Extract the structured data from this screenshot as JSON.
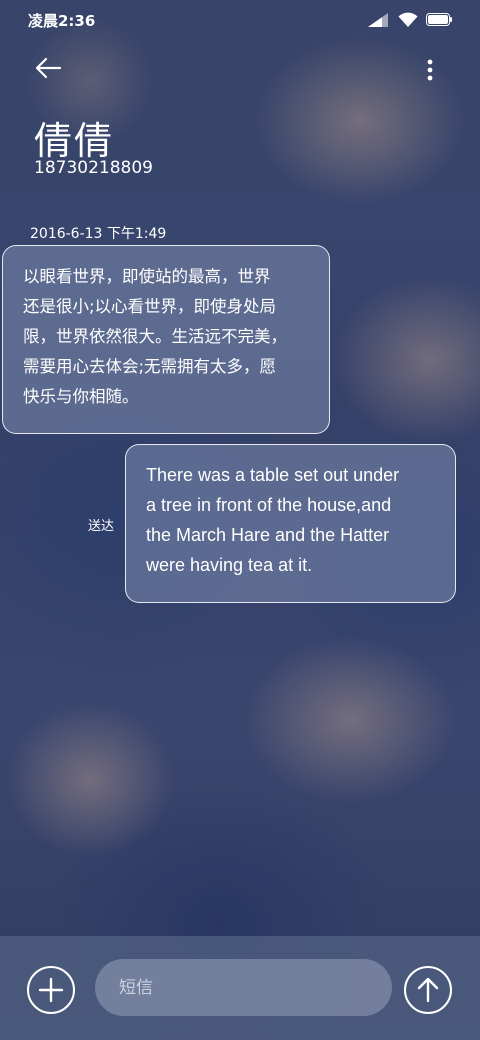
{
  "status_bar": {
    "time": "凌晨2:36"
  },
  "header": {
    "back_icon": "arrow-left-icon",
    "more_icon": "more-vertical-icon",
    "contact_name": "倩倩",
    "contact_number": "18730218809"
  },
  "conversation": {
    "timestamp": "2016-6-13 下午1:49",
    "messages": [
      {
        "direction": "incoming",
        "lines": [
          "以眼看世界，即使站的最高，世界",
          "还是很小;以心看世界，即使身处局",
          "限，世界依然很大。生活远不完美，",
          "需要用心去体会;无需拥有太多，愿",
          "快乐与你相随。"
        ]
      },
      {
        "direction": "outgoing",
        "status": "送达",
        "lines": [
          "There was a table set out under",
          "a tree in front of the house,and",
          "the March Hare and the Hatter",
          "were having tea at it."
        ]
      }
    ]
  },
  "compose": {
    "add_icon": "plus-circle-icon",
    "placeholder": "短信",
    "value": "",
    "send_icon": "arrow-up-circle-icon"
  },
  "colors": {
    "bubble_fill": "#7e8cb0",
    "bubble_border": "#ffffff",
    "compose_bar": "#4e5e80",
    "text": "#ffffff"
  }
}
